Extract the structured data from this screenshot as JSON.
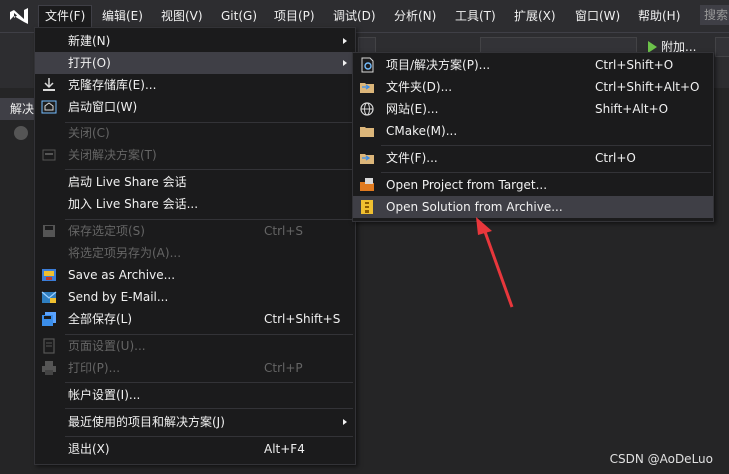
{
  "menubar": {
    "items": [
      "文件(F)",
      "编辑(E)",
      "视图(V)",
      "Git(G)",
      "项目(P)",
      "调试(D)",
      "分析(N)",
      "工具(T)",
      "扩展(X)",
      "窗口(W)",
      "帮助(H)"
    ],
    "search": "搜索"
  },
  "toolbar": {
    "run_label": "附加..."
  },
  "side": {
    "tab_label": "解决"
  },
  "file_menu": {
    "items": [
      {
        "label": "新建(N)",
        "shortcut": "",
        "submenu": true,
        "enabled": true,
        "icon": "none"
      },
      {
        "label": "打开(O)",
        "shortcut": "",
        "submenu": true,
        "enabled": true,
        "icon": "none"
      },
      {
        "label": "克隆存储库(E)...",
        "shortcut": "",
        "submenu": false,
        "enabled": true,
        "icon": "download-icon"
      },
      {
        "label": "启动窗口(W)",
        "shortcut": "",
        "submenu": false,
        "enabled": true,
        "icon": "home-window-icon"
      },
      {
        "label": "关闭(C)",
        "shortcut": "",
        "submenu": false,
        "enabled": false,
        "icon": "none"
      },
      {
        "label": "关闭解决方案(T)",
        "shortcut": "",
        "submenu": false,
        "enabled": false,
        "icon": "close-solution-icon"
      },
      {
        "label": "启动 Live Share 会话",
        "shortcut": "",
        "submenu": false,
        "enabled": true,
        "icon": "none"
      },
      {
        "label": "加入 Live Share 会话...",
        "shortcut": "",
        "submenu": false,
        "enabled": true,
        "icon": "none"
      },
      {
        "label": "保存选定项(S)",
        "shortcut": "Ctrl+S",
        "submenu": false,
        "enabled": false,
        "icon": "save-icon"
      },
      {
        "label": "将选定项另存为(A)...",
        "shortcut": "",
        "submenu": false,
        "enabled": false,
        "icon": "none"
      },
      {
        "label": "Save  as Archive...",
        "shortcut": "",
        "submenu": false,
        "enabled": true,
        "icon": "archive-icon"
      },
      {
        "label": "Send  by E-Mail...",
        "shortcut": "",
        "submenu": false,
        "enabled": true,
        "icon": "email-archive-icon"
      },
      {
        "label": "全部保存(L)",
        "shortcut": "Ctrl+Shift+S",
        "submenu": false,
        "enabled": true,
        "icon": "save-all-icon"
      },
      {
        "label": "页面设置(U)...",
        "shortcut": "",
        "submenu": false,
        "enabled": false,
        "icon": "page-setup-icon"
      },
      {
        "label": "打印(P)...",
        "shortcut": "Ctrl+P",
        "submenu": false,
        "enabled": false,
        "icon": "print-icon"
      },
      {
        "label": "帐户设置(I)...",
        "shortcut": "",
        "submenu": false,
        "enabled": true,
        "icon": "none"
      },
      {
        "label": "最近使用的项目和解决方案(J)",
        "shortcut": "",
        "submenu": true,
        "enabled": true,
        "icon": "none"
      },
      {
        "label": "退出(X)",
        "shortcut": "Alt+F4",
        "submenu": false,
        "enabled": true,
        "icon": "none"
      }
    ]
  },
  "open_submenu": {
    "items": [
      {
        "label": "项目/解决方案(P)...",
        "shortcut": "Ctrl+Shift+O",
        "icon": "project-solution-icon"
      },
      {
        "label": "文件夹(D)...",
        "shortcut": "Ctrl+Shift+Alt+O",
        "icon": "folder-icon"
      },
      {
        "label": "网站(E)...",
        "shortcut": "Shift+Alt+O",
        "icon": "website-icon"
      },
      {
        "label": "CMake(M)...",
        "shortcut": "",
        "icon": "cmake-folder-icon"
      },
      {
        "label": "文件(F)...",
        "shortcut": "Ctrl+O",
        "icon": "open-file-icon"
      },
      {
        "label": "Open Project from Target...",
        "shortcut": "",
        "icon": "open-target-icon"
      },
      {
        "label": "Open Solution from Archive...",
        "shortcut": "",
        "icon": "open-archive-icon"
      }
    ]
  },
  "watermark": "CSDN @AoDeLuo",
  "colors": {
    "accent": "#68217a",
    "highlight": "#3f3f46",
    "menu_bg": "#1b1b1c",
    "arrow": "#e8373c"
  }
}
